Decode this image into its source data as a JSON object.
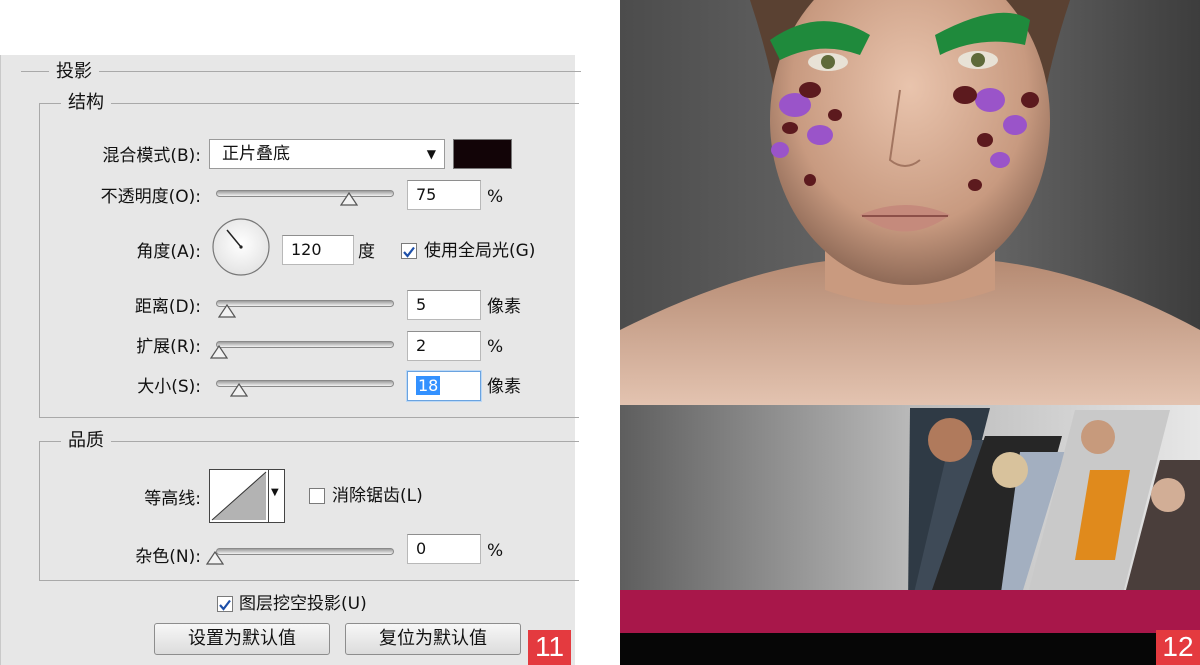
{
  "dialog": {
    "section_title": "投影",
    "structure": {
      "title": "结构",
      "blend_mode": {
        "label": "混合模式(B):",
        "value": "正片叠底",
        "color": "#120407"
      },
      "opacity": {
        "label": "不透明度(O):",
        "value": "75",
        "unit": "%",
        "slider_fraction": 0.75
      },
      "angle": {
        "label": "角度(A):",
        "value": "120",
        "unit": "度"
      },
      "global_light": {
        "label": "使用全局光(G)",
        "checked": true
      },
      "distance": {
        "label": "距离(D):",
        "value": "5",
        "unit": "像素",
        "slider_fraction": 0.02
      },
      "spread": {
        "label": "扩展(R):",
        "value": "2",
        "unit": "%",
        "slider_fraction": 0.02
      },
      "size": {
        "label": "大小(S):",
        "value": "18",
        "unit": "像素",
        "slider_fraction": 0.07
      }
    },
    "quality": {
      "title": "品质",
      "contour": {
        "label": "等高线:"
      },
      "anti_alias": {
        "label": "消除锯齿(L)",
        "checked": false
      },
      "noise": {
        "label": "杂色(N):",
        "value": "0",
        "unit": "%",
        "slider_fraction": 0.0
      }
    },
    "knockout": {
      "label": "图层挖空投影(U)",
      "checked": true
    },
    "buttons": {
      "set_default": "设置为默认值",
      "reset_default": "复位为默认值"
    },
    "badge": "11"
  },
  "photo": {
    "badge": "12",
    "accent_color": "#a8174a"
  }
}
